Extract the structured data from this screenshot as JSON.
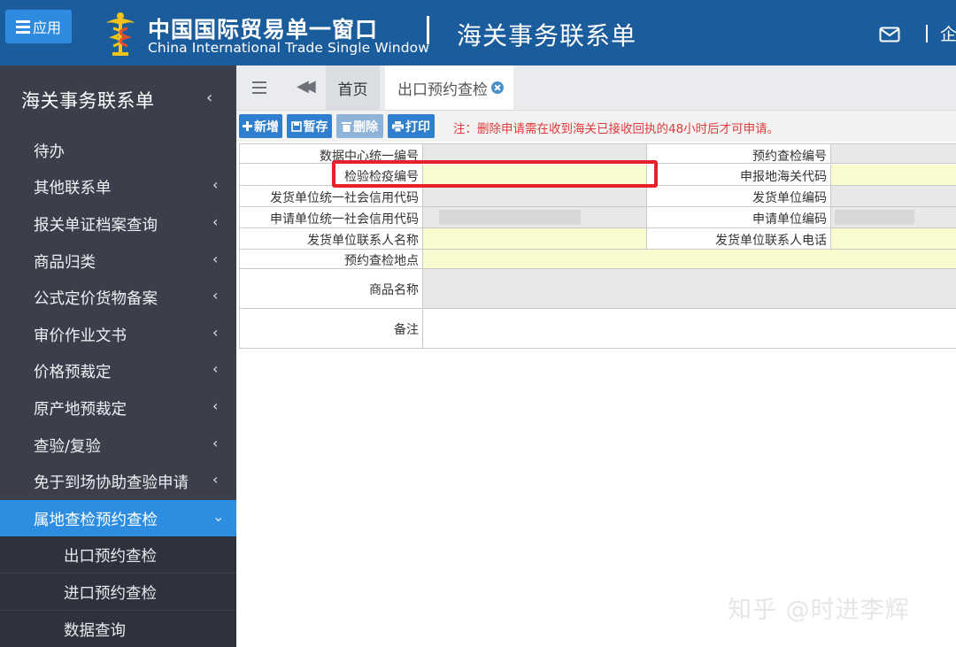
{
  "header": {
    "app_button_label": "应用",
    "brand_cn": "中国国际贸易单一窗口",
    "brand_en": "China International Trade Single Window",
    "page_heading": "海关事务联系单",
    "truncated_right_text": "企"
  },
  "sidebar": {
    "title": "海关事务联系单",
    "title_arrow": "‹",
    "items": [
      {
        "label": "待办",
        "arrow": ""
      },
      {
        "label": "其他联系单",
        "arrow": "‹"
      },
      {
        "label": "报关单证档案查询",
        "arrow": "‹"
      },
      {
        "label": "商品归类",
        "arrow": "‹"
      },
      {
        "label": "公式定价货物备案",
        "arrow": "‹"
      },
      {
        "label": "审价作业文书",
        "arrow": "‹"
      },
      {
        "label": "价格预裁定",
        "arrow": "‹"
      },
      {
        "label": "原产地预裁定",
        "arrow": "‹"
      },
      {
        "label": "查验/复验",
        "arrow": "‹"
      },
      {
        "label": "免于到场协助查验申请",
        "arrow": "‹"
      },
      {
        "label": "属地查检预约查检",
        "arrow": "⌄"
      }
    ],
    "subitems": [
      {
        "label": "出口预约查检"
      },
      {
        "label": "进口预约查检"
      },
      {
        "label": "数据查询"
      }
    ]
  },
  "tabs": {
    "home": "首页",
    "active": "出口预约查检"
  },
  "toolbar": {
    "new_label": "新增",
    "save_label": "暂存",
    "delete_label": "删除",
    "print_label": "打印",
    "notice": "注：删除申请需在收到海关已接收回执的48小时后才可申请。"
  },
  "form": {
    "data_center_no": "数据中心统一编号",
    "reservation_no": "预约查检编号",
    "inspection_no": "检验检疫编号",
    "customs_code": "申报地海关代码",
    "shipper_credit_code": "发货单位统一社会信用代码",
    "shipper_code": "发货单位编码",
    "applicant_credit_code": "申请单位统一社会信用代码",
    "applicant_code": "申请单位编码",
    "shipper_contact": "发货单位联系人名称",
    "shipper_phone": "发货单位联系人电话",
    "inspection_place": "预约查检地点",
    "goods_name": "商品名称",
    "remarks": "备注"
  },
  "watermark": "知乎 @时进李辉",
  "colors": {
    "header_bg": "#1b5d9c",
    "sidebar_bg": "#3a3f4b",
    "accent": "#2d8de1",
    "highlight_border": "#e8202a",
    "required_field": "#fbfbd0"
  }
}
